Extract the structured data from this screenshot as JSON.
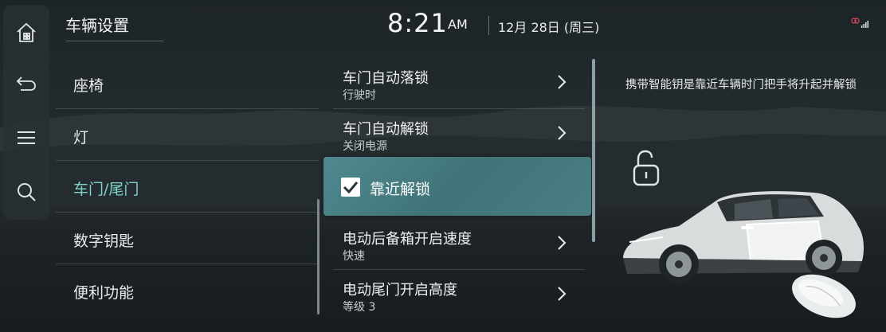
{
  "header": {
    "title": "车辆设置",
    "time": "8:21",
    "ampm": "AM",
    "date": "12月 28日 (周三)"
  },
  "nav_rail": {
    "icons": [
      "home-icon",
      "back-icon",
      "menu-icon",
      "search-icon"
    ]
  },
  "left_menu": {
    "items": [
      {
        "label": "座椅"
      },
      {
        "label": "灯"
      },
      {
        "label": "车门/尾门"
      },
      {
        "label": "数字钥匙"
      },
      {
        "label": "便利功能"
      }
    ],
    "active_index": 2
  },
  "settings": {
    "items": [
      {
        "label": "车门自动落锁",
        "value": "行驶时"
      },
      {
        "label": "车门自动解锁",
        "value": "关闭电源"
      },
      {
        "label": "靠近解锁",
        "checked": true
      },
      {
        "label": "电动后备箱开启速度",
        "value": "快速"
      },
      {
        "label": "电动尾门开启高度",
        "value": "等级 3"
      }
    ]
  },
  "detail": {
    "description": "携带智能钥是靠近车辆时门把手将升起并解锁"
  },
  "colors": {
    "accent": "#7fd3c9",
    "selected_bg": "#4a8084"
  }
}
